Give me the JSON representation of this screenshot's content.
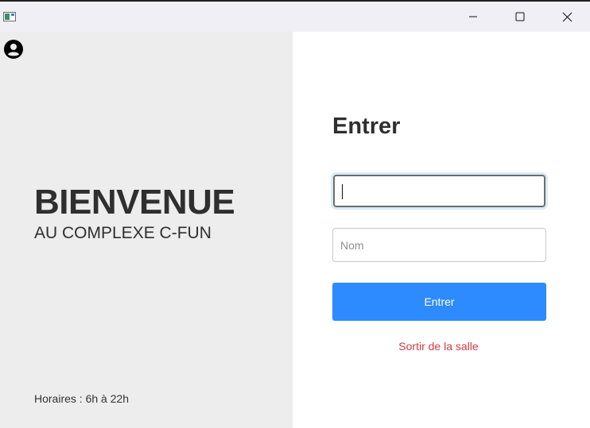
{
  "window": {
    "icon": "app-window-icon",
    "controls": {
      "minimize": "minimize-icon",
      "maximize": "maximize-icon",
      "close": "close-icon"
    }
  },
  "welcome": {
    "title": "BIENVENUE",
    "subtitle": "AU COMPLEXE C-FUN",
    "hours": "Horaires : 6h à 22h",
    "user_icon": "user-account-icon"
  },
  "form": {
    "title": "Entrer",
    "code_value": "",
    "name_value": "",
    "name_placeholder": "Nom",
    "submit_label": "Entrer",
    "exit_label": "Sortir de la salle"
  },
  "colors": {
    "left_bg": "#ededed",
    "accent": "#2e8bff",
    "danger": "#d13a47",
    "text": "#2f2f2f"
  }
}
